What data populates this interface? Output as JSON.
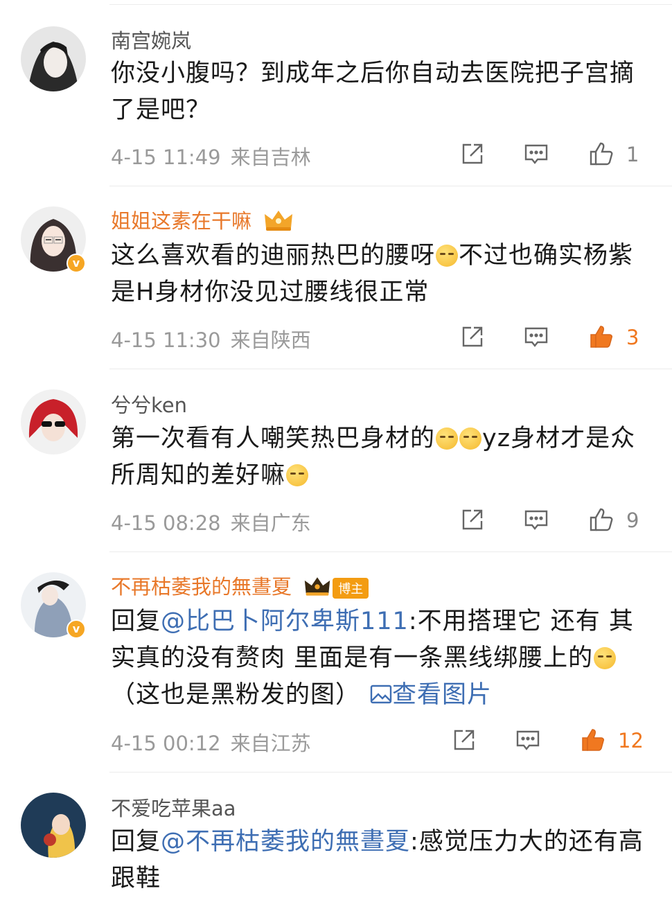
{
  "comments": [
    {
      "user": "南宫婉岚",
      "text": "你没小腹吗？到成年之后你自动去医院把子宫摘了是吧？",
      "time": "4-15 11:49",
      "location": "来自吉林",
      "likes": "1",
      "liked": false,
      "verified": false
    },
    {
      "user": "姐姐这素在干嘛",
      "text_a": "这么喜欢看的迪丽热巴的腰呀",
      "text_b": "不过也确实杨紫是H身材你没见过腰线很正常",
      "time": "4-15 11:30",
      "location": "来自陕西",
      "likes": "3",
      "liked": true,
      "verified": true
    },
    {
      "user": "兮兮ken",
      "text_a": "第一次看有人嘲笑热巴身材的",
      "text_b": "yz身材才是众所周知的差好嘛",
      "time": "4-15 08:28",
      "location": "来自广东",
      "likes": "9",
      "liked": false,
      "verified": false
    },
    {
      "user": "不再枯萎我的無晝夏",
      "badge": "博主",
      "reply_prefix": "回复",
      "mention": "@比巴卜阿尔卑斯111",
      "text_a": ":不用搭理它 还有 其实真的没有赘肉 里面是有一条黑线绑腰上的",
      "text_b": "（这也是黑粉发的图）",
      "image_link": "查看图片",
      "time": "4-15 00:12",
      "location": "来自江苏",
      "likes": "12",
      "liked": true,
      "verified": true
    },
    {
      "user": "不爱吃苹果aa",
      "reply_prefix": "回复",
      "mention": "@不再枯萎我的無晝夏",
      "text_a": ":感觉压力大的还有高跟鞋",
      "verified": false
    }
  ],
  "icons": {
    "share": "share-icon",
    "comment": "comment-icon",
    "like": "thumbs-up-icon",
    "crown": "crown-icon",
    "verified": "verified-badge-icon",
    "emoji": "emoji-icon",
    "image": "image-icon"
  },
  "colors": {
    "liked": "#f07820",
    "vip_name": "#e8782a",
    "mention": "#3e6eb3"
  }
}
